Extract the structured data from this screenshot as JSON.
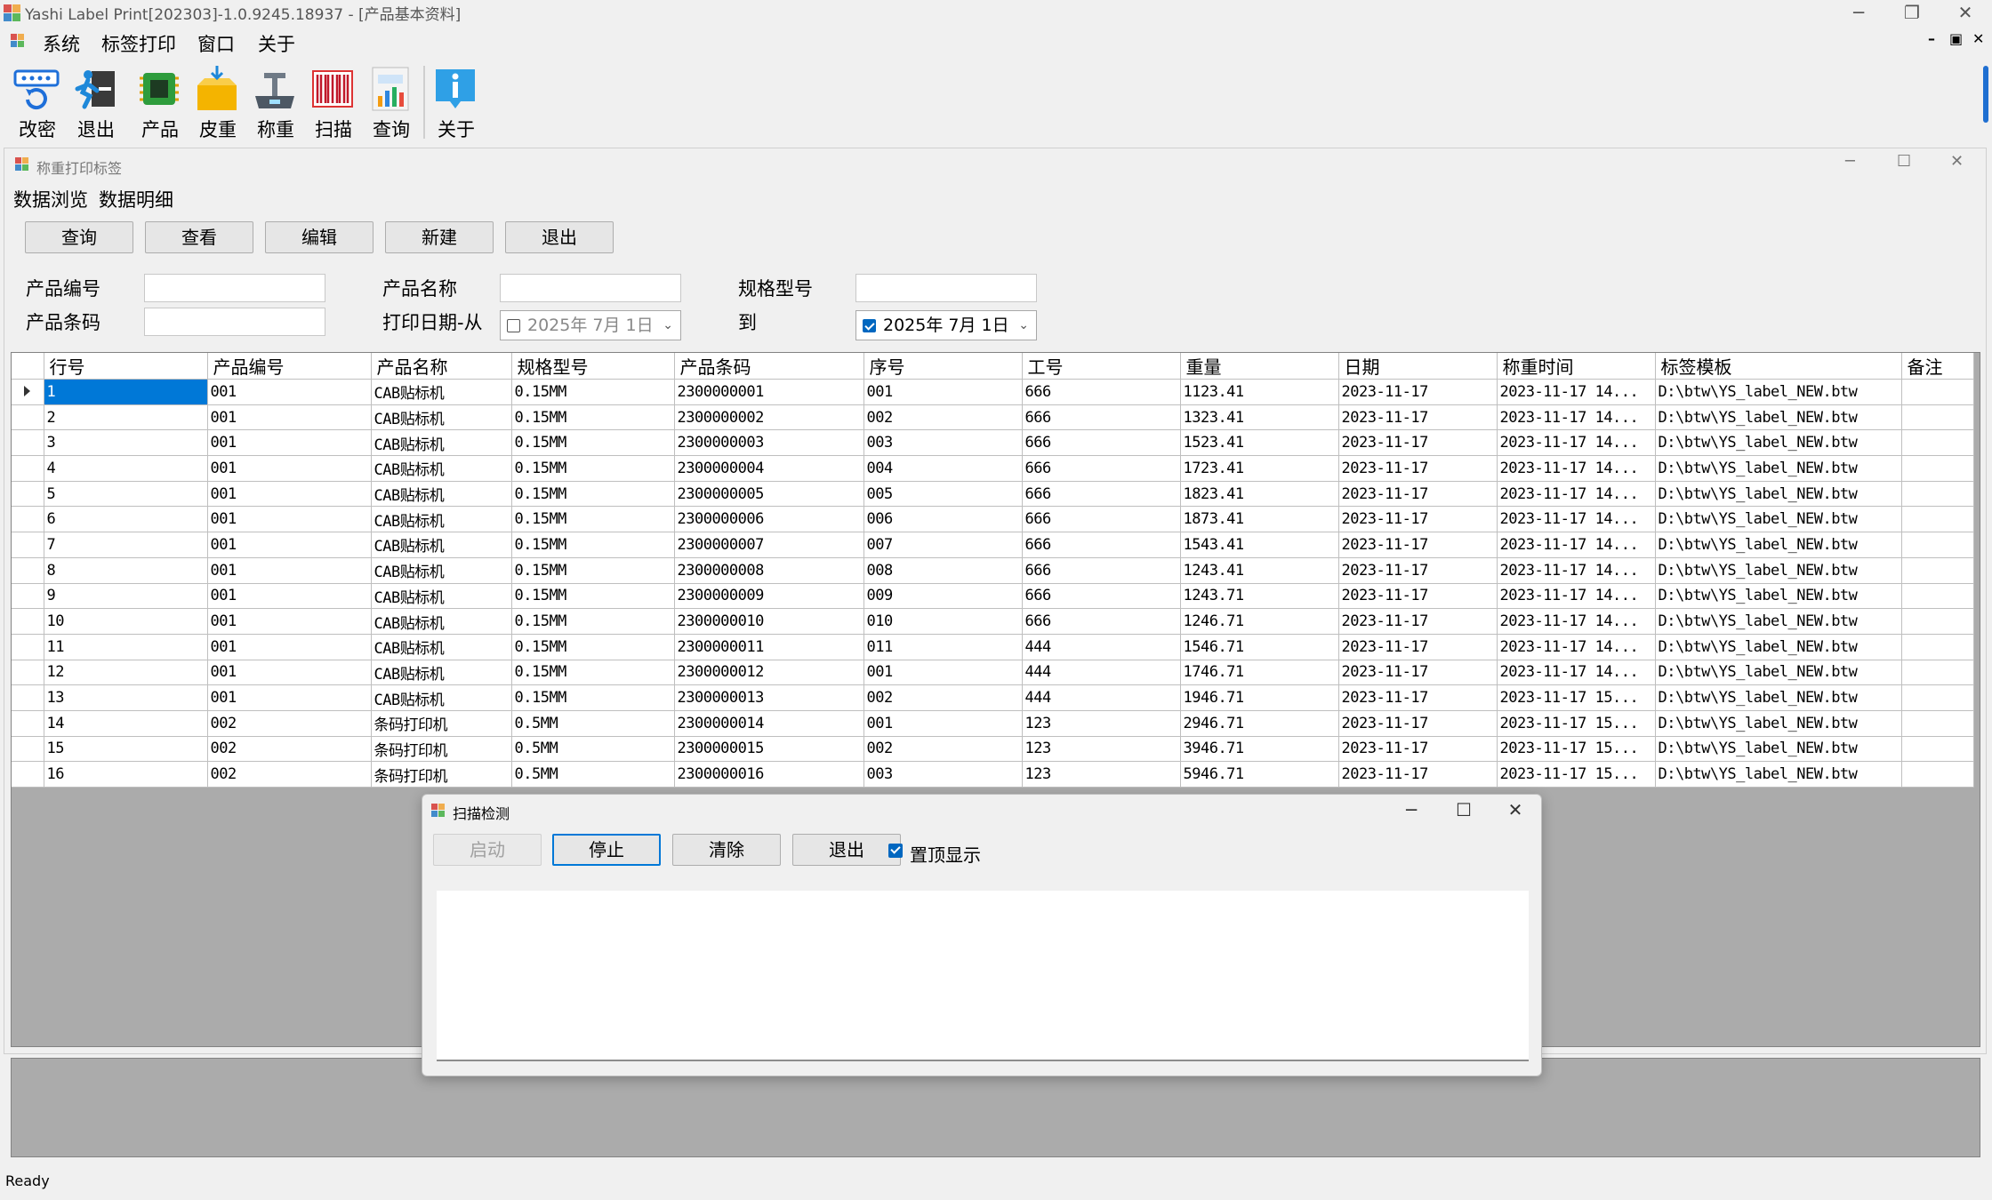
{
  "app": {
    "title": "Yashi Label Print[202303]-1.0.9245.18937 - [产品基本资料]"
  },
  "menu": [
    "系统",
    "标签打印",
    "窗口",
    "关于"
  ],
  "toolbar": [
    {
      "label": "改密",
      "icon": "password-icon"
    },
    {
      "label": "退出",
      "icon": "exit-icon"
    },
    {
      "label": "产品",
      "icon": "product-chip-icon"
    },
    {
      "label": "皮重",
      "icon": "tare-box-icon"
    },
    {
      "label": "称重",
      "icon": "scale-icon"
    },
    {
      "label": "扫描",
      "icon": "barcode-icon"
    },
    {
      "label": "查询",
      "icon": "report-icon"
    },
    {
      "label": "关于",
      "icon": "info-icon"
    }
  ],
  "child": {
    "title": "称重打印标签",
    "tabs": [
      "数据浏览",
      "数据明细"
    ],
    "buttons": [
      "查询",
      "查看",
      "编辑",
      "新建",
      "退出"
    ],
    "filters": {
      "product_code_label": "产品编号",
      "product_name_label": "产品名称",
      "spec_label": "规格型号",
      "barcode_label": "产品条码",
      "print_date_from_label": "打印日期-从",
      "to_label": "到",
      "date_from": "2025年 7月 1日",
      "date_to": "2025年 7月 1日"
    },
    "grid": {
      "columns": [
        "行号",
        "产品编号",
        "产品名称",
        "规格型号",
        "产品条码",
        "序号",
        "工号",
        "重量",
        "日期",
        "称重时间",
        "标签模板",
        "备注"
      ],
      "rows": [
        [
          "1",
          "001",
          "CAB贴标机",
          "0.15MM",
          "2300000001",
          "001",
          "666",
          "1123.41",
          "2023-11-17",
          "2023-11-17 14...",
          "D:\\btw\\YS_label_NEW.btw",
          ""
        ],
        [
          "2",
          "001",
          "CAB贴标机",
          "0.15MM",
          "2300000002",
          "002",
          "666",
          "1323.41",
          "2023-11-17",
          "2023-11-17 14...",
          "D:\\btw\\YS_label_NEW.btw",
          ""
        ],
        [
          "3",
          "001",
          "CAB贴标机",
          "0.15MM",
          "2300000003",
          "003",
          "666",
          "1523.41",
          "2023-11-17",
          "2023-11-17 14...",
          "D:\\btw\\YS_label_NEW.btw",
          ""
        ],
        [
          "4",
          "001",
          "CAB贴标机",
          "0.15MM",
          "2300000004",
          "004",
          "666",
          "1723.41",
          "2023-11-17",
          "2023-11-17 14...",
          "D:\\btw\\YS_label_NEW.btw",
          ""
        ],
        [
          "5",
          "001",
          "CAB贴标机",
          "0.15MM",
          "2300000005",
          "005",
          "666",
          "1823.41",
          "2023-11-17",
          "2023-11-17 14...",
          "D:\\btw\\YS_label_NEW.btw",
          ""
        ],
        [
          "6",
          "001",
          "CAB贴标机",
          "0.15MM",
          "2300000006",
          "006",
          "666",
          "1873.41",
          "2023-11-17",
          "2023-11-17 14...",
          "D:\\btw\\YS_label_NEW.btw",
          ""
        ],
        [
          "7",
          "001",
          "CAB贴标机",
          "0.15MM",
          "2300000007",
          "007",
          "666",
          "1543.41",
          "2023-11-17",
          "2023-11-17 14...",
          "D:\\btw\\YS_label_NEW.btw",
          ""
        ],
        [
          "8",
          "001",
          "CAB贴标机",
          "0.15MM",
          "2300000008",
          "008",
          "666",
          "1243.41",
          "2023-11-17",
          "2023-11-17 14...",
          "D:\\btw\\YS_label_NEW.btw",
          ""
        ],
        [
          "9",
          "001",
          "CAB贴标机",
          "0.15MM",
          "2300000009",
          "009",
          "666",
          "1243.71",
          "2023-11-17",
          "2023-11-17 14...",
          "D:\\btw\\YS_label_NEW.btw",
          ""
        ],
        [
          "10",
          "001",
          "CAB贴标机",
          "0.15MM",
          "2300000010",
          "010",
          "666",
          "1246.71",
          "2023-11-17",
          "2023-11-17 14...",
          "D:\\btw\\YS_label_NEW.btw",
          ""
        ],
        [
          "11",
          "001",
          "CAB贴标机",
          "0.15MM",
          "2300000011",
          "011",
          "444",
          "1546.71",
          "2023-11-17",
          "2023-11-17 14...",
          "D:\\btw\\YS_label_NEW.btw",
          ""
        ],
        [
          "12",
          "001",
          "CAB贴标机",
          "0.15MM",
          "2300000012",
          "001",
          "444",
          "1746.71",
          "2023-11-17",
          "2023-11-17 14...",
          "D:\\btw\\YS_label_NEW.btw",
          ""
        ],
        [
          "13",
          "001",
          "CAB贴标机",
          "0.15MM",
          "2300000013",
          "002",
          "444",
          "1946.71",
          "2023-11-17",
          "2023-11-17 15...",
          "D:\\btw\\YS_label_NEW.btw",
          ""
        ],
        [
          "14",
          "002",
          "条码打印机",
          "0.5MM",
          "2300000014",
          "001",
          "123",
          "2946.71",
          "2023-11-17",
          "2023-11-17 15...",
          "D:\\btw\\YS_label_NEW.btw",
          ""
        ],
        [
          "15",
          "002",
          "条码打印机",
          "0.5MM",
          "2300000015",
          "002",
          "123",
          "3946.71",
          "2023-11-17",
          "2023-11-17 15...",
          "D:\\btw\\YS_label_NEW.btw",
          ""
        ],
        [
          "16",
          "002",
          "条码打印机",
          "0.5MM",
          "2300000016",
          "003",
          "123",
          "5946.71",
          "2023-11-17",
          "2023-11-17 15...",
          "D:\\btw\\YS_label_NEW.btw",
          ""
        ]
      ]
    }
  },
  "scan_dialog": {
    "title": "扫描检测",
    "start_label": "启动",
    "stop_label": "停止",
    "clear_label": "清除",
    "exit_label": "退出",
    "topmost_label": "置顶显示",
    "topmost_checked": true
  },
  "status": {
    "text": "Ready"
  },
  "colors": {
    "selection": "#0078d7",
    "mdi_background": "#ababab",
    "checkbox": "#0067c0"
  }
}
